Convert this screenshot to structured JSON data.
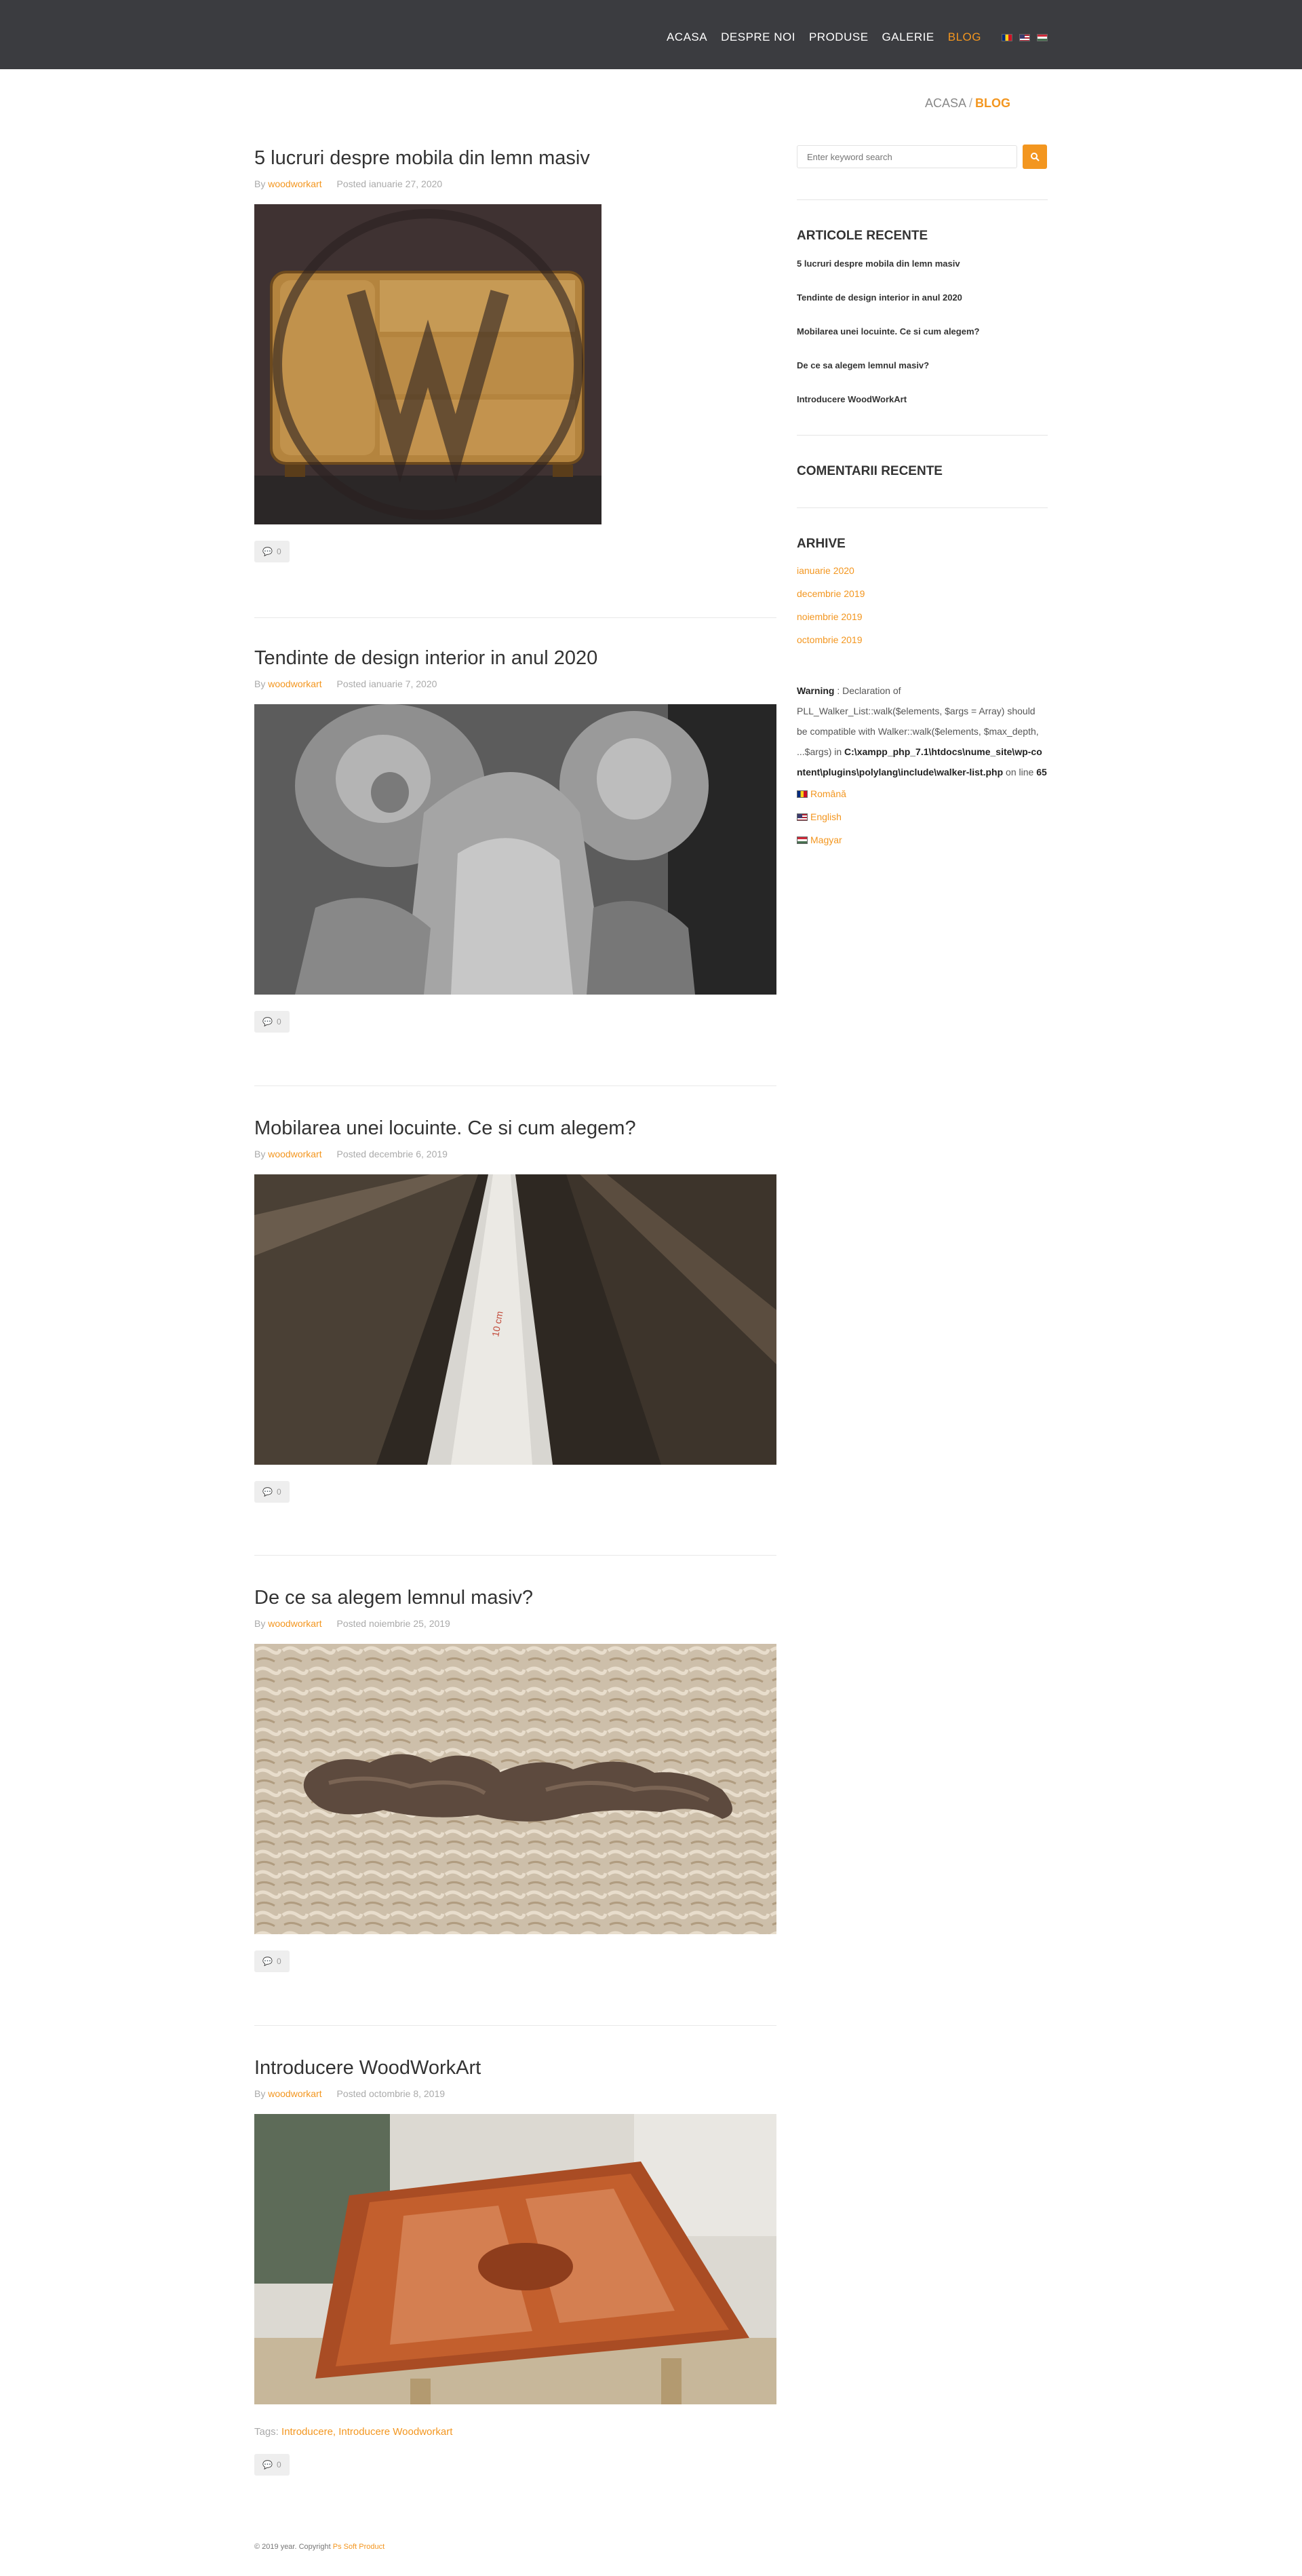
{
  "nav": {
    "items": [
      "ACASA",
      "DESPRE NOI",
      "PRODUSE",
      "GALERIE",
      "BLOG"
    ],
    "active": "BLOG",
    "flags": [
      "flag-ro-icon",
      "flag-en-icon",
      "flag-hu-icon"
    ]
  },
  "breadcrumb": {
    "home": "ACASA",
    "separator": "/",
    "current": "BLOG"
  },
  "posts": [
    {
      "title": "5 lucruri despre mobila din lemn masiv",
      "by": "By",
      "author": "woodworkart",
      "posted": "Posted ianuarie 27, 2020",
      "image": "sideboard-with-logo-watermark",
      "tags_label": "",
      "tags": "",
      "comments": "0"
    },
    {
      "title": "Tendinte de design interior in anul 2020",
      "by": "By",
      "author": "woodworkart",
      "posted": "Posted ianuarie 7, 2020",
      "image": "carved-wood-closeup",
      "tags_label": "",
      "tags": "",
      "comments": "0"
    },
    {
      "title": "Mobilarea unei locuinte. Ce si cum alegem?",
      "by": "By",
      "author": "woodworkart",
      "posted": "Posted decembrie 6, 2019",
      "image": "measuring-tape-on-wood",
      "tags_label": "",
      "tags": "",
      "comments": "0"
    },
    {
      "title": "De ce sa alegem lemnul masiv?",
      "by": "By",
      "author": "woodworkart",
      "posted": "Posted noiembrie 25, 2019",
      "image": "carved-ornament-on-shavings",
      "tags_label": "",
      "tags": "",
      "comments": "0"
    },
    {
      "title": "Introducere WoodWorkArt",
      "by": "By",
      "author": "woodworkart",
      "posted": "Posted octombrie 8, 2019",
      "image": "varnished-door-workshop",
      "tags_label": "Tags:",
      "tags": "Introducere, Introducere Woodworkart",
      "comments": "0"
    }
  ],
  "sidebar": {
    "search_placeholder": "Enter keyword search",
    "recent_title": "ARTICOLE RECENTE",
    "recent": [
      "5 lucruri despre mobila din lemn masiv",
      "Tendinte de design interior in anul 2020",
      "Mobilarea unei locuinte. Ce si cum alegem?",
      "De ce sa alegem lemnul masiv?",
      "Introducere WoodWorkArt"
    ],
    "comments_title": "COMENTARII RECENTE",
    "archive_title": "ARHIVE",
    "archives": [
      "ianuarie 2020",
      "decembrie 2019",
      "noiembrie 2019",
      "octombrie 2019"
    ],
    "warning": {
      "label": "Warning",
      "text1": ": Declaration of PLL_Walker_List::walk($elements, $args = Array) should be compatible with Walker::walk($elements, $max_depth, ...$args) in",
      "path": "C:\\xampp_php_7.1\\htdocs\\nume_site\\wp-content\\plugins\\polylang\\include\\walker-list.php",
      "text2": "on line",
      "line": "65"
    },
    "languages": [
      "Română",
      "English",
      "Magyar"
    ]
  },
  "footer": {
    "text": "© 2019 year. Copyright",
    "link": "Ps Soft Product"
  },
  "colors": {
    "accent": "#f3961f",
    "header_bg": "#3b3c40"
  }
}
